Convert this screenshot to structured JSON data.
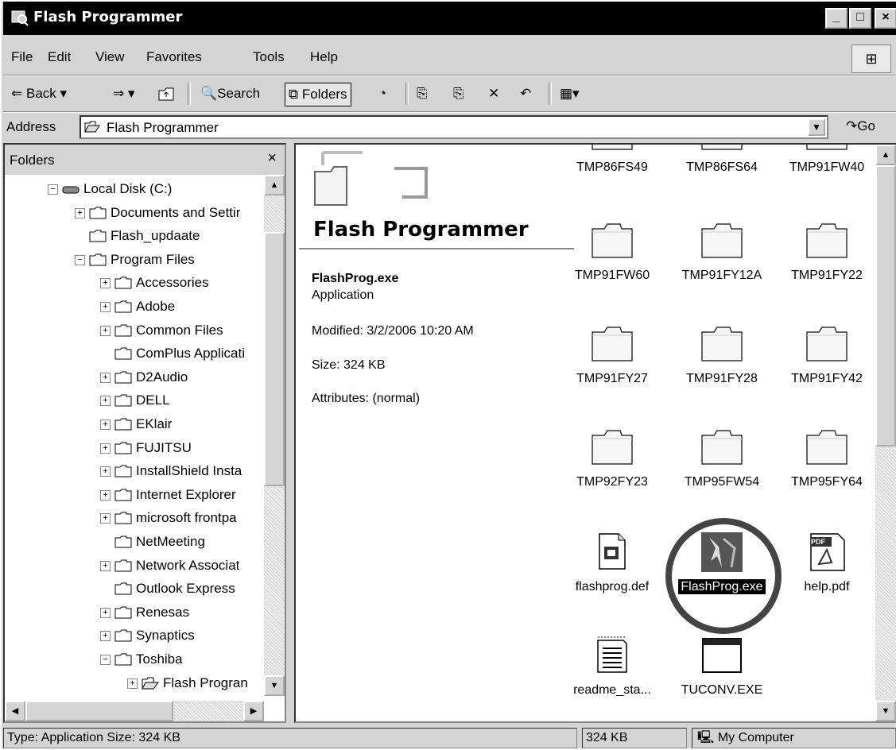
{
  "window": {
    "title": "Flash Programmer",
    "min_label": "_",
    "max_label": "□",
    "close_label": "×"
  },
  "menu": [
    "File",
    "Edit",
    "View",
    "Favorites",
    "Tools",
    "Help"
  ],
  "toolbar": {
    "back": "Back",
    "search": "Search",
    "folders": "Folders"
  },
  "address": {
    "label": "Address",
    "value": "Flash Programmer",
    "go": "Go"
  },
  "folders_pane": {
    "title": "Folders",
    "close": "×",
    "tree": [
      {
        "label": "Local Disk (C:)",
        "expander": "−",
        "type": "drive"
      },
      {
        "label": "Documents and Settir",
        "expander": "+",
        "type": "folder"
      },
      {
        "label": "Flash_updaate",
        "expander": "",
        "type": "folder"
      },
      {
        "label": "Program Files",
        "expander": "−",
        "type": "folder"
      },
      {
        "label": "Accessories",
        "expander": "+",
        "type": "folder"
      },
      {
        "label": "Adobe",
        "expander": "+",
        "type": "folder"
      },
      {
        "label": "Common Files",
        "expander": "+",
        "type": "folder"
      },
      {
        "label": "ComPlus Applicati",
        "expander": "",
        "type": "folder"
      },
      {
        "label": "D2Audio",
        "expander": "+",
        "type": "folder"
      },
      {
        "label": "DELL",
        "expander": "+",
        "type": "folder"
      },
      {
        "label": "EKlair",
        "expander": "+",
        "type": "folder"
      },
      {
        "label": "FUJITSU",
        "expander": "+",
        "type": "folder"
      },
      {
        "label": "InstallShield Insta",
        "expander": "+",
        "type": "folder"
      },
      {
        "label": "Internet Explorer",
        "expander": "+",
        "type": "folder"
      },
      {
        "label": "microsoft frontpa",
        "expander": "+",
        "type": "folder"
      },
      {
        "label": "NetMeeting",
        "expander": "",
        "type": "folder"
      },
      {
        "label": "Network Associat",
        "expander": "+",
        "type": "folder"
      },
      {
        "label": "Outlook Express",
        "expander": "",
        "type": "folder"
      },
      {
        "label": "Renesas",
        "expander": "+",
        "type": "folder"
      },
      {
        "label": "Synaptics",
        "expander": "+",
        "type": "folder"
      },
      {
        "label": "Toshiba",
        "expander": "−",
        "type": "folder"
      },
      {
        "label": "Flash Progran",
        "expander": "+",
        "type": "open-folder"
      }
    ]
  },
  "info_panel": {
    "title": "Flash Programmer",
    "file_name": "FlashProg.exe",
    "file_type": "Application",
    "modified": "Modified: 3/2/2006 10:20 AM",
    "size": "Size: 324 KB",
    "attributes": "Attributes: (normal)"
  },
  "files": [
    {
      "name": "TMP86FS49",
      "kind": "folder-partial"
    },
    {
      "name": "TMP86FS64",
      "kind": "folder-partial"
    },
    {
      "name": "TMP91FW40",
      "kind": "folder-partial"
    },
    {
      "name": "TMP91FW60",
      "kind": "folder"
    },
    {
      "name": "TMP91FY12A",
      "kind": "folder"
    },
    {
      "name": "TMP91FY22",
      "kind": "folder"
    },
    {
      "name": "TMP91FY27",
      "kind": "folder"
    },
    {
      "name": "TMP91FY28",
      "kind": "folder"
    },
    {
      "name": "TMP91FY42",
      "kind": "folder"
    },
    {
      "name": "TMP92FY23",
      "kind": "folder"
    },
    {
      "name": "TMP95FW54",
      "kind": "folder"
    },
    {
      "name": "TMP95FY64",
      "kind": "folder"
    },
    {
      "name": "flashprog.def",
      "kind": "def-file"
    },
    {
      "name": "FlashProg.exe",
      "kind": "exe",
      "selected": true
    },
    {
      "name": "help.pdf",
      "kind": "pdf",
      "badge": "PDF"
    },
    {
      "name": "readme_sta...",
      "kind": "text"
    },
    {
      "name": "TUCONV.EXE",
      "kind": "window-exe"
    }
  ],
  "status": {
    "left": "Type: Application Size: 324 KB",
    "size": "324 KB",
    "zone": "My Computer"
  }
}
